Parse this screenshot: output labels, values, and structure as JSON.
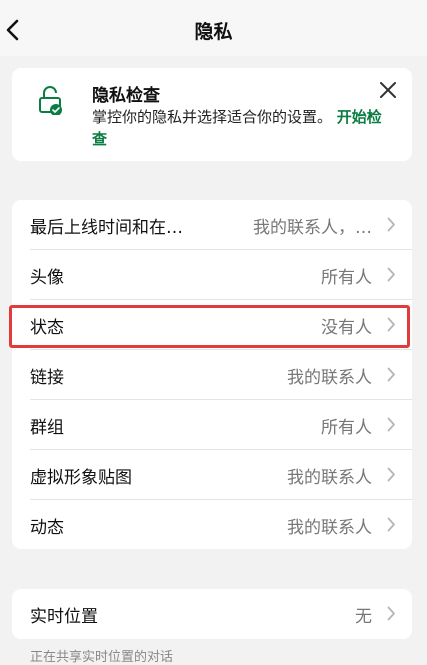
{
  "header": {
    "title": "隐私"
  },
  "privacy_checkup": {
    "title": "隐私检查",
    "description": "掌控你的隐私并选择适合你的设置。",
    "action_label": "开始检查"
  },
  "settings": [
    {
      "label": "最后上线时间和在…",
      "value": "我的联系人，…"
    },
    {
      "label": "头像",
      "value": "所有人"
    },
    {
      "label": "状态",
      "value": "没有人"
    },
    {
      "label": "链接",
      "value": "我的联系人"
    },
    {
      "label": "群组",
      "value": "所有人"
    },
    {
      "label": "虚拟形象贴图",
      "value": "我的联系人"
    },
    {
      "label": "动态",
      "value": "我的联系人"
    }
  ],
  "live_location": {
    "label": "实时位置",
    "value": "无"
  },
  "footer_note": "正在共享实时位置的对话",
  "colors": {
    "accent": "#0a7d43",
    "highlight": "#e23b3b"
  }
}
